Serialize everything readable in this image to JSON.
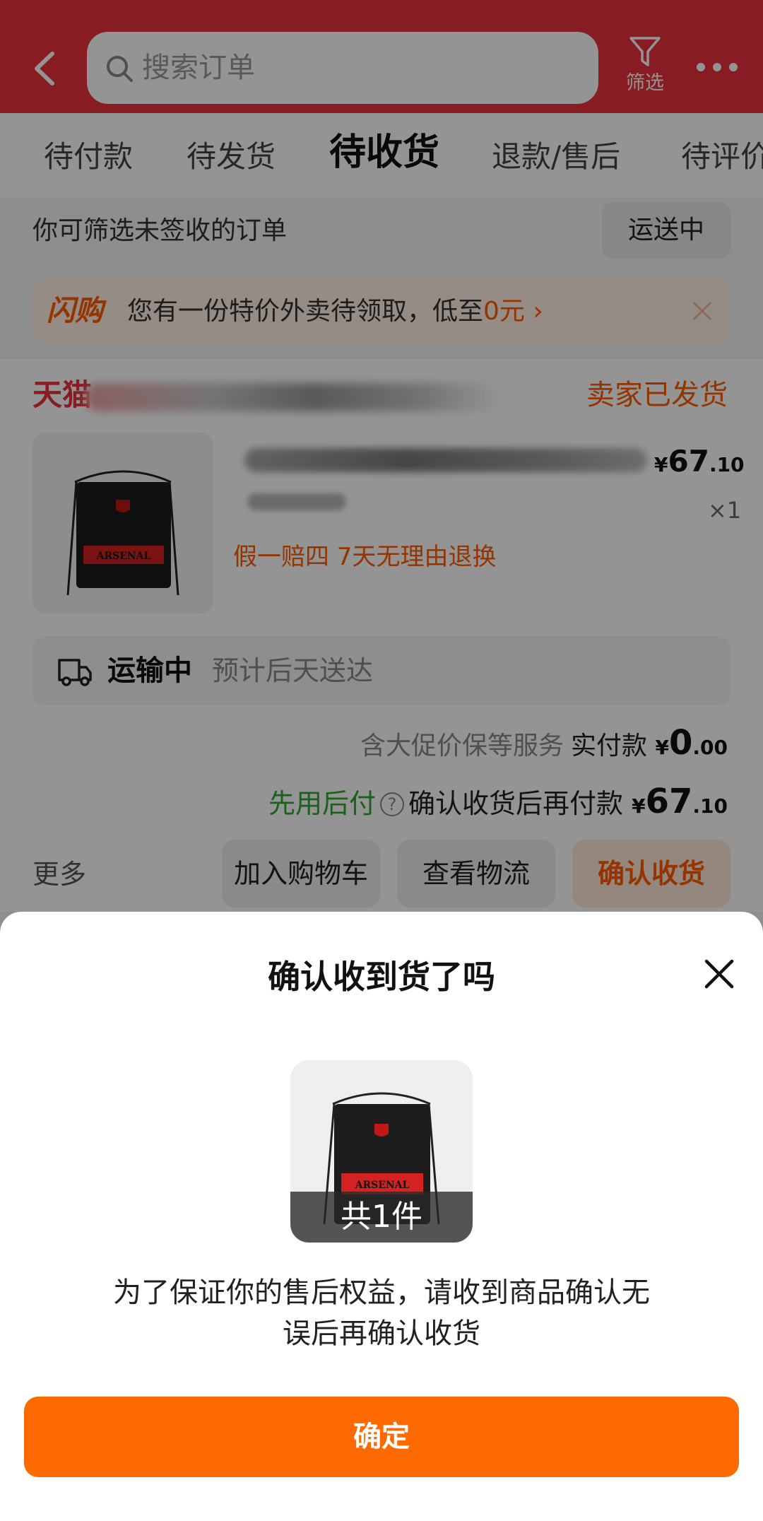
{
  "header": {
    "search_placeholder": "搜索订单",
    "filter_label": "筛选"
  },
  "tabs": [
    "待付款",
    "待发货",
    "待收货",
    "退款/售后",
    "待评价"
  ],
  "active_tab": "待收货",
  "filter_hint": "你可筛选未签收的订单",
  "shipping_filter": "运送中",
  "promo": {
    "logo": "闪购",
    "text": "您有一份特价外卖待领取，低至",
    "value": "0元"
  },
  "order": {
    "shop_prefix": "天猫",
    "status": "卖家已发货",
    "price_symbol": "¥",
    "price_int": "67",
    "price_dec": ".10",
    "quantity": "×1",
    "tags": "假一赔四  7天无理由退换",
    "product_print": "ARSENAL",
    "logistics_title": "运输中",
    "logistics_desc": "预计后天送达",
    "service_text": "含大促价保等服务",
    "paid_label": "实付款",
    "paid_symbol": "¥",
    "paid_int": "0",
    "paid_dec": ".00",
    "bnpl": "先用后付",
    "help": "?",
    "after_label": "确认收货后再付款",
    "after_symbol": "¥",
    "after_int": "67",
    "after_dec": ".10",
    "more": "更多",
    "buttons": {
      "add_cart": "加入购物车",
      "logistics": "查看物流",
      "confirm": "确认收货"
    }
  },
  "sheet": {
    "title": "确认收到货了吗",
    "count": "共1件",
    "message": "为了保证你的售后权益，请收到商品确认无误后再确认收货",
    "ok": "确定"
  },
  "colors": {
    "header_red": "#e8333b",
    "accent_orange": "#ff6a00",
    "bnpl_green": "#2fa832"
  }
}
